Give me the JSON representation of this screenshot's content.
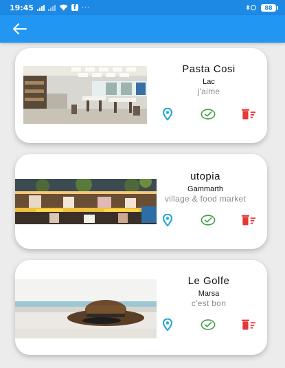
{
  "status_bar": {
    "time": "19:45",
    "dots": "···",
    "battery": "88",
    "icons": [
      "signal-icon",
      "wifi-icon",
      "facebook-icon",
      "bluetooth-icon",
      "battery-icon"
    ]
  },
  "app_bar": {
    "back_icon": "arrow-left-icon",
    "color": "#2196f3"
  },
  "places": [
    {
      "name": "Pasta Cosi",
      "location": "Lac",
      "comment": "j'aime"
    },
    {
      "name": "utopia",
      "location": "Gammarth",
      "comment": "village & food market"
    },
    {
      "name": "Le Golfe",
      "location": "Marsa",
      "comment": "c'est bon"
    }
  ],
  "action_icons": {
    "location": "location-pin-icon",
    "check": "check-circle-icon",
    "delete": "delete-sweep-icon"
  },
  "colors": {
    "status_bar": "#1e88e5",
    "location_icon": "#26a9d6",
    "check_icon": "#43a047",
    "delete_icon": "#e53935"
  }
}
